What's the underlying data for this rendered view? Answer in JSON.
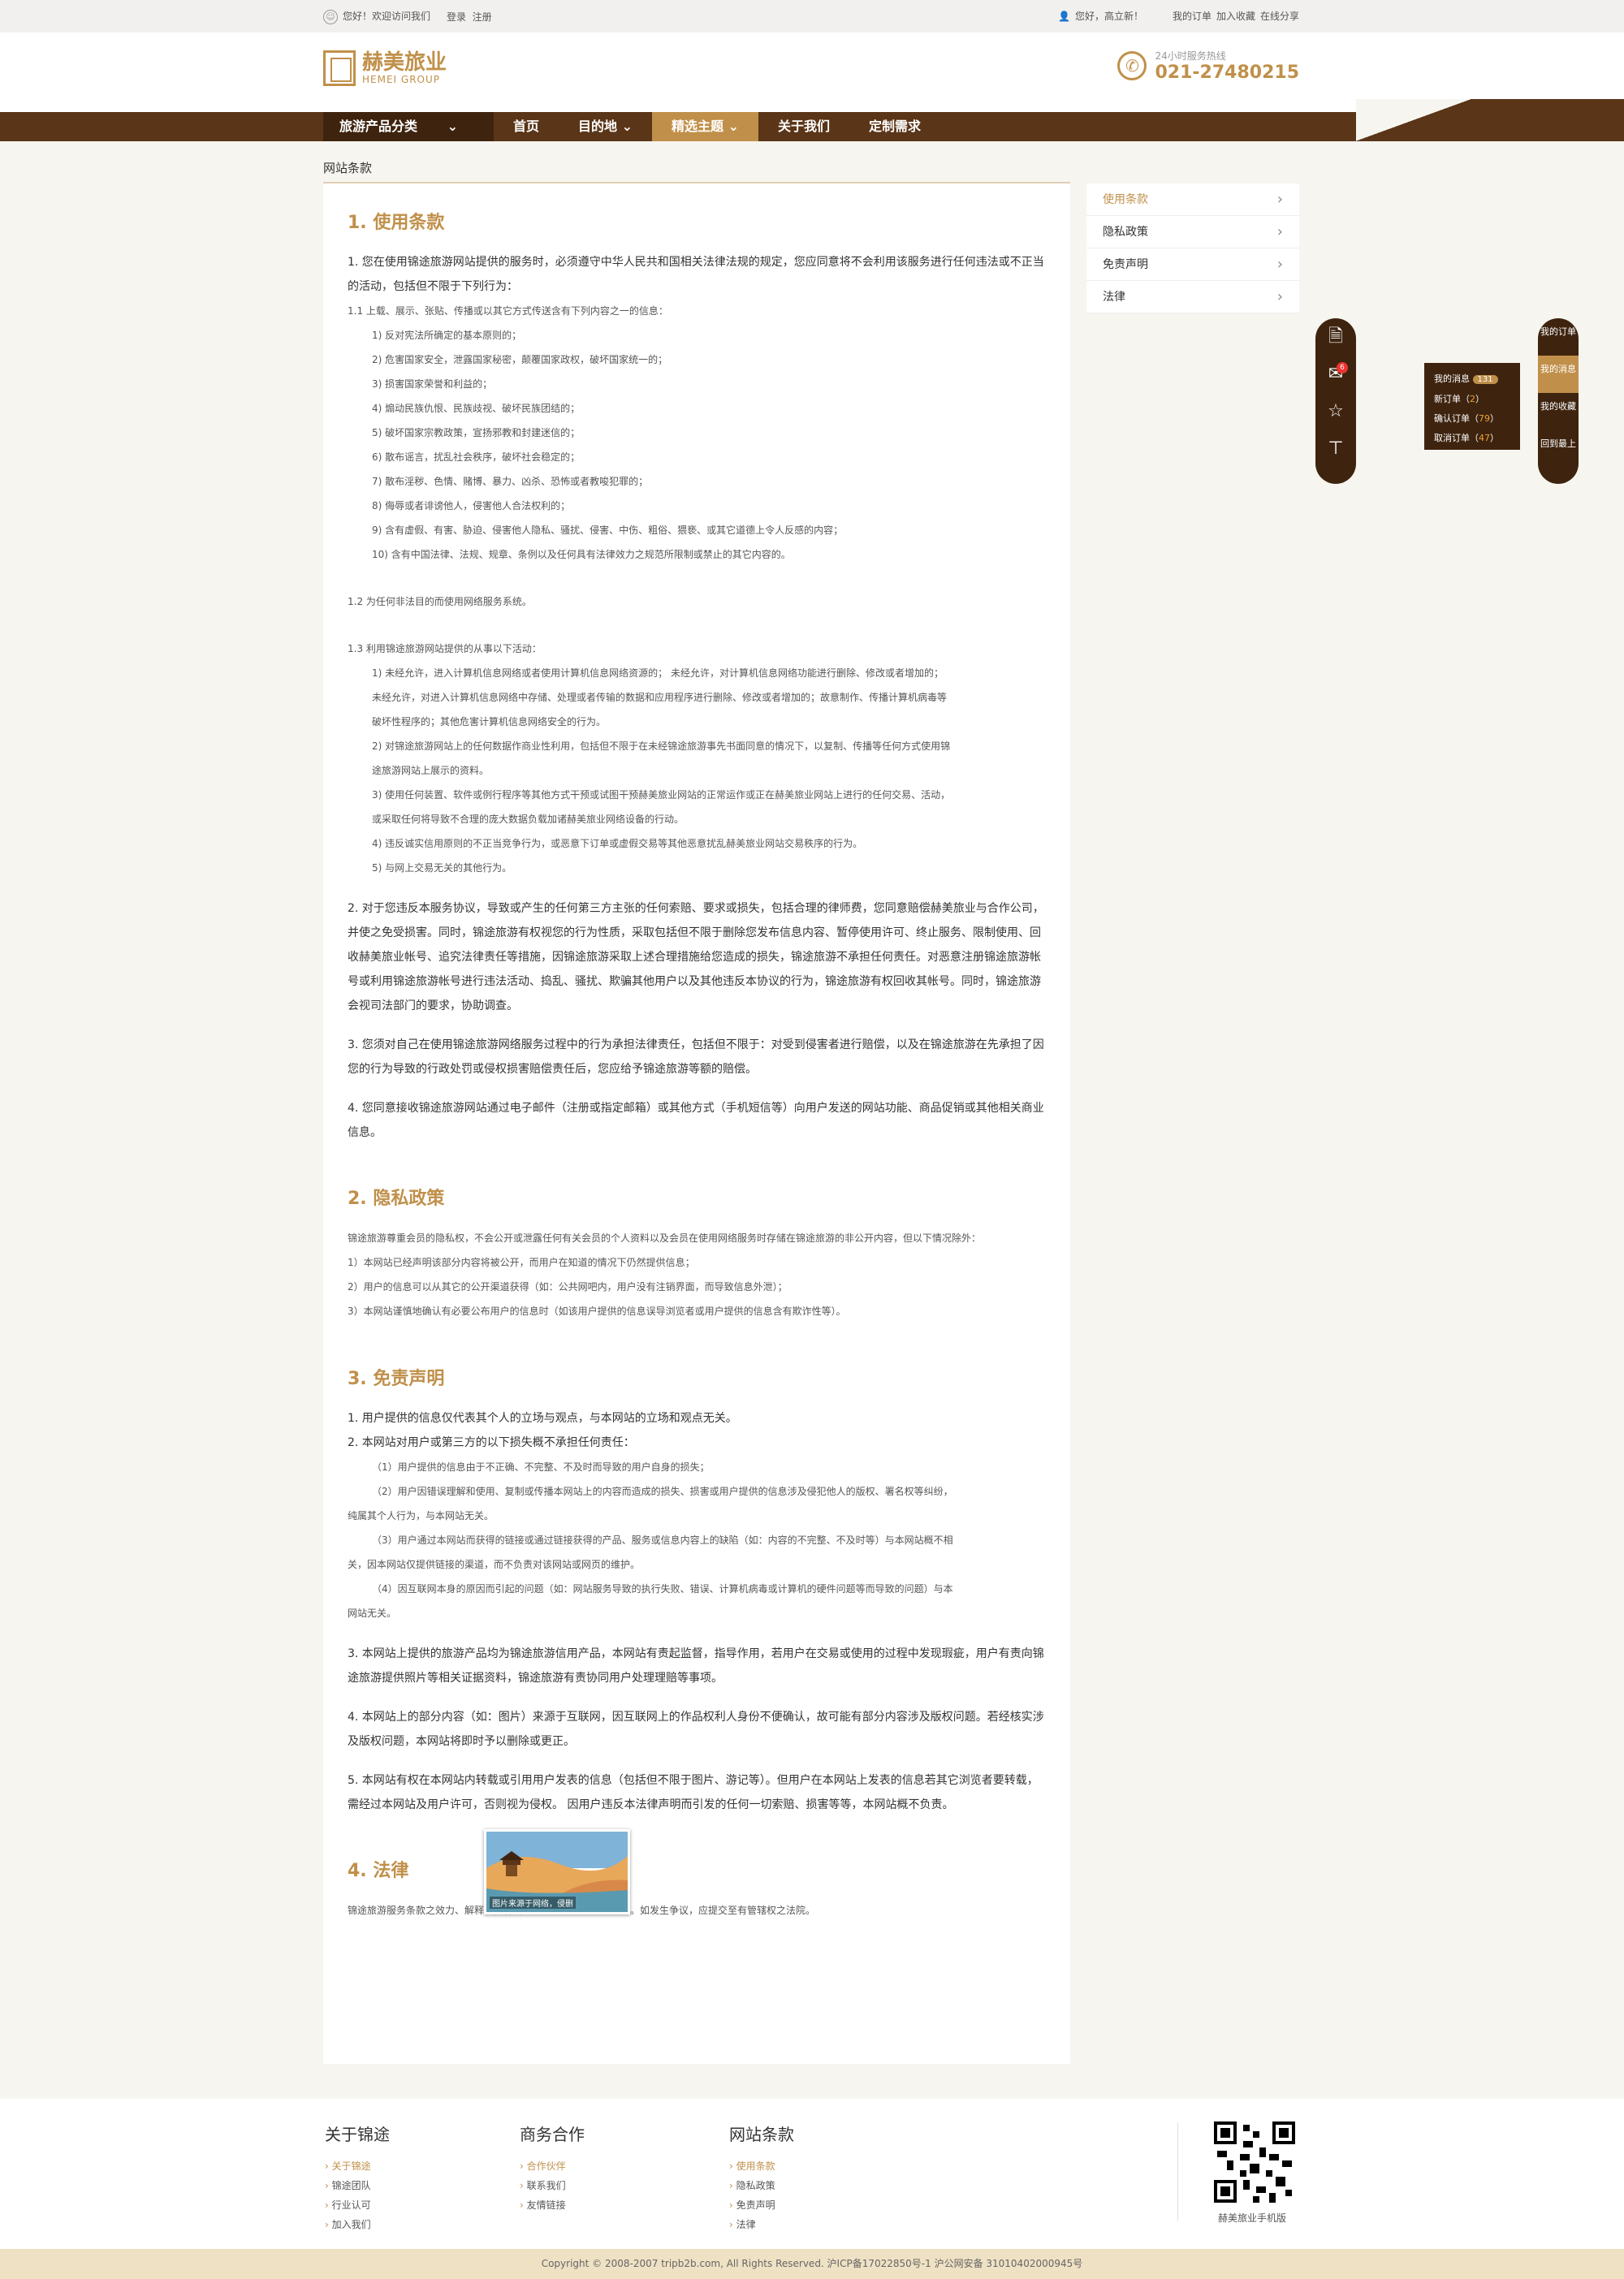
{
  "topbar": {
    "greeting": "您好！欢迎访问我们",
    "login": "登录",
    "register": "注册",
    "user": "您好，高立新！",
    "my_orders": "我的订单",
    "favorite": "加入收藏",
    "share": "在线分享"
  },
  "header": {
    "logo_cn": "赫美旅业",
    "logo_en": "HEMEI GROUP",
    "hotline_label": "24小时服务热线",
    "hotline": "021-27480215"
  },
  "nav": {
    "items": [
      "旅游产品分类",
      "首页",
      "目的地",
      "精选主题",
      "关于我们",
      "定制需求"
    ]
  },
  "breadcrumb": "网站条款",
  "sidebar": {
    "items": [
      "使用条款",
      "隐私政策",
      "免责声明",
      "法律"
    ]
  },
  "tools": {
    "icons": [
      "document-icon",
      "mail-icon",
      "star-icon",
      "top-icon"
    ],
    "mail_badge": "6"
  },
  "right_bar": {
    "items": [
      "我的订单",
      "我的消息",
      "我的收藏",
      "回到最上"
    ]
  },
  "messages_popup": {
    "title": "我的消息",
    "count": "131",
    "new_label": "新订单（",
    "new": "2",
    "confirm_label": "确认订单（",
    "confirm": "79",
    "cancel_label": "取消订单（",
    "cancel": "47",
    "close": "）"
  },
  "content": {
    "s1_title": "1. 使用条款",
    "s1_p1": "1. 您在使用锦途旅游网站提供的服务时，必须遵守中华人民共和国相关法律法规的规定，您应同意将不会利用该服务进行任何违法或不正当的活动，包括但不限于下列行为：",
    "s1_11": "1.1 上载、展示、张贴、传播或以其它方式传送含有下列内容之一的信息：",
    "s1_11_items": [
      "1) 反对宪法所确定的基本原则的；",
      "2) 危害国家安全，泄露国家秘密，颠覆国家政权，破坏国家统一的；",
      "3) 损害国家荣誉和利益的；",
      "4) 煽动民族仇恨、民族歧视、破坏民族团结的；",
      "5) 破坏国家宗教政策，宣扬邪教和封建迷信的；",
      "6) 散布谣言，扰乱社会秩序，破坏社会稳定的；",
      "7) 散布淫秽、色情、赌博、暴力、凶杀、恐怖或者教唆犯罪的；",
      "8) 侮辱或者诽谤他人，侵害他人合法权利的；",
      "9) 含有虚假、有害、胁迫、侵害他人隐私、骚扰、侵害、中伤、粗俗、猥亵、或其它道德上令人反感的内容；",
      "10) 含有中国法律、法规、规章、条例以及任何具有法律效力之规范所限制或禁止的其它内容的。"
    ],
    "s1_12": "1.2 为任何非法目的而使用网络服务系统。",
    "s1_13": "1.3 利用锦途旅游网站提供的从事以下活动：",
    "s1_13_items": [
      "1) 未经允许，进入计算机信息网络或者使用计算机信息网络资源的； 未经允许，对计算机信息网络功能进行删除、修改或者增加的；",
      "未经允许，对进入计算机信息网络中存储、处理或者传输的数据和应用程序进行删除、修改或者增加的；故意制作、传播计算机病毒等",
      "破坏性程序的；其他危害计算机信息网络安全的行为。",
      "2) 对锦途旅游网站上的任何数据作商业性利用，包括但不限于在未经锦途旅游事先书面同意的情况下，以复制、传播等任何方式使用锦",
      "途旅游网站上展示的资料。",
      "3) 使用任何装置、软件或例行程序等其他方式干预或试图干预赫美旅业网站的正常运作或正在赫美旅业网站上进行的任何交易、活动，",
      "或采取任何将导致不合理的庞大数据负载加诸赫美旅业网络设备的行动。",
      "4) 违反诚实信用原则的不正当竞争行为，或恶意下订单或虚假交易等其他恶意扰乱赫美旅业网站交易秩序的行为。",
      "5) 与网上交易无关的其他行为。"
    ],
    "s1_p2": "2. 对于您违反本服务协议，导致或产生的任何第三方主张的任何索赔、要求或损失，包括合理的律师费，您同意赔偿赫美旅业与合作公司，并使之免受损害。同时，锦途旅游有权视您的行为性质，采取包括但不限于删除您发布信息内容、暂停使用许可、终止服务、限制使用、回收赫美旅业帐号、追究法律责任等措施，因锦途旅游采取上述合理措施给您造成的损失，锦途旅游不承担任何责任。对恶意注册锦途旅游帐号或利用锦途旅游帐号进行违法活动、捣乱、骚扰、欺骗其他用户以及其他违反本协议的行为，锦途旅游有权回收其帐号。同时，锦途旅游会视司法部门的要求，协助调查。",
    "s1_p3": "3. 您须对自己在使用锦途旅游网络服务过程中的行为承担法律责任，包括但不限于：对受到侵害者进行赔偿，以及在锦途旅游在先承担了因您的行为导致的行政处罚或侵权损害赔偿责任后，您应给予锦途旅游等额的赔偿。",
    "s1_p4": "4. 您同意接收锦途旅游网站通过电子邮件（注册或指定邮箱）或其他方式（手机短信等）向用户发送的网站功能、商品促销或其他相关商业信息。",
    "s2_title": "2. 隐私政策",
    "s2_p": "锦途旅游尊重会员的隐私权，不会公开或泄露任何有关会员的个人资料以及会员在使用网络服务时存储在锦途旅游的非公开内容，但以下情况除外：",
    "s2_items": [
      "1）本网站已经声明该部分内容将被公开，而用户在知道的情况下仍然提供信息；",
      "2）用户的信息可以从其它的公开渠道获得（如：公共网吧内，用户没有注销界面，而导致信息外泄）；",
      "3）本网站谨慎地确认有必要公布用户的信息时（如该用户提供的信息误导浏览者或用户提供的信息含有欺诈性等）。"
    ],
    "s3_title": "3. 免责声明",
    "s3_p1": "1. 用户提供的信息仅代表其个人的立场与观点，与本网站的立场和观点无关。",
    "s3_p2": "2. 本网站对用户或第三方的以下损失概不承担任何责任：",
    "s3_items": [
      "（1）用户提供的信息由于不正确、不完整、不及时而导致的用户自身的损失；",
      "（2）用户因错误理解和使用、复制或传播本网站上的内容而造成的损失、损害或用户提供的信息涉及侵犯他人的版权、署名权等纠纷，",
      "纯属其个人行为，与本网站无关。",
      "（3）用户通过本网站而获得的链接或通过链接获得的产品、服务或信息内容上的缺陷（如：内容的不完整、不及时等）与本网站概不相",
      "关，因本网站仅提供链接的渠道，而不负责对该网站或网页的维护。",
      "（4）因互联网本身的原因而引起的问题（如：网站服务导致的执行失败、错误、计算机病毒或计算机的硬件问题等而导致的问题）与本",
      "网站无关。"
    ],
    "s3_p3": "3. 本网站上提供的旅游产品均为锦途旅游信用产品，本网站有责起监督，指导作用，若用户在交易或使用的过程中发现瑕疵，用户有责向锦途旅游提供照片等相关证据资料，锦途旅游有责协同用户处理理赔等事项。",
    "s3_p4": "4. 本网站上的部分内容（如：图片）来源于互联网，因互联网上的作品权利人身份不便确认，故可能有部分内容涉及版权问题。若经核实涉及版权问题，本网站将即时予以删除或更正。",
    "s3_p5": "5. 本网站有权在本网站内转载或引用用户发表的信息（包括但不限于图片、游记等）。但用户在本网站上发表的信息若其它浏览者要转载，需经过本网站及用户许可，否则视为侵权。 因用户违反本法律声明而引发的任何一切索赔、损害等等，本网站概不负责。",
    "s4_title": "4. 法律",
    "s4_p": "锦途旅游服务条款之效力、解释、执行均适用中华人民共和国法律。如发生争议，应提交至有管辖权之法院。"
  },
  "image_caption": "图片来源于网络，侵删",
  "footer": {
    "col1_title": "关于锦途",
    "col1": [
      "关于锦途",
      "锦途团队",
      "行业认可",
      "加入我们"
    ],
    "col2_title": "商务合作",
    "col2": [
      "合作伙伴",
      "联系我们",
      "友情链接"
    ],
    "col3_title": "网站条款",
    "col3": [
      "使用条款",
      "隐私政策",
      "免责声明",
      "法律"
    ],
    "qr_caption": "赫美旅业手机版",
    "copyright": "Copyright © 2008-2007 tripb2b.com, All Rights Reserved.     沪ICP备17022850号-1 沪公网安备 31010402000945号"
  },
  "colors": {
    "brand": "#c0904a",
    "nav": "#5a3518",
    "dark": "#3e240f"
  }
}
